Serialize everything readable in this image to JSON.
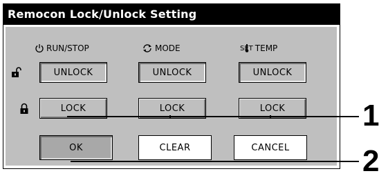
{
  "window": {
    "title": "Remocon Lock/Unlock Setting"
  },
  "columns": [
    {
      "label": "RUN/STOP",
      "icon": "power-icon",
      "unlock_label": "UNLOCK",
      "lock_label": "LOCK"
    },
    {
      "label": "MODE",
      "icon": "mode-cycle-icon",
      "unlock_label": "UNLOCK",
      "lock_label": "LOCK"
    },
    {
      "label": "TEMP",
      "icon_text": "SET",
      "icon": "thermometer-icon",
      "unlock_label": "UNLOCK",
      "lock_label": "LOCK"
    }
  ],
  "rows": {
    "unlock_icon": "unlocked-padlock-icon",
    "lock_icon": "locked-padlock-icon"
  },
  "footer": {
    "ok_label": "OK",
    "clear_label": "CLEAR",
    "cancel_label": "CANCEL"
  },
  "callouts": {
    "first": "1",
    "second": "2"
  }
}
